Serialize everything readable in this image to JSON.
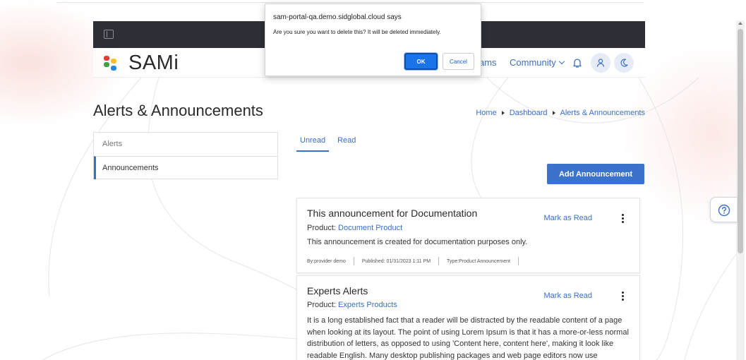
{
  "dialog": {
    "title": "sam-portal-qa.demo.sidglobal.cloud says",
    "message": "Are you sure you want to delete this? It will be deleted immediately.",
    "ok_label": "OK",
    "cancel_label": "Cancel"
  },
  "navbar": {
    "logo_text": "SAMi",
    "teams_label": "ams",
    "community_label": "Community",
    "icons": [
      "bell-icon",
      "user-icon",
      "moon-icon"
    ]
  },
  "page": {
    "title": "Alerts & Announcements"
  },
  "breadcrumb": [
    "Home",
    "Dashboard",
    "Alerts & Announcements"
  ],
  "side_menu": [
    {
      "label": "Alerts",
      "active": false
    },
    {
      "label": "Announcements",
      "active": true
    }
  ],
  "tabs": [
    {
      "label": "Unread",
      "active": true
    },
    {
      "label": "Read",
      "active": false
    }
  ],
  "add_button_label": "Add Announcement",
  "product_prefix": "Product:",
  "mark_read_label": "Mark as Read",
  "cards": [
    {
      "title": "This announcement for Documentation",
      "product": "Document Product",
      "description": "This announcement is created for documentation purposes only.",
      "by": "By:provider demo",
      "published": "Published: 01/31/2023 1:11 PM",
      "type": "Type:Product Announcement"
    },
    {
      "title": "Experts Alerts",
      "product": "Experts Products",
      "description": "It is a long established fact that a reader will be distracted by the readable content of a page when looking at its layout. The point of using Lorem Ipsum is that it has a more-or-less normal distribution of letters, as opposed to using 'Content here, content here', making it look like readable English. Many desktop publishing packages and web page editors now use"
    }
  ],
  "colors": {
    "accent": "#3a72cc",
    "topbar": "#2e2f36",
    "dialog_ok": "#1a73e8"
  }
}
